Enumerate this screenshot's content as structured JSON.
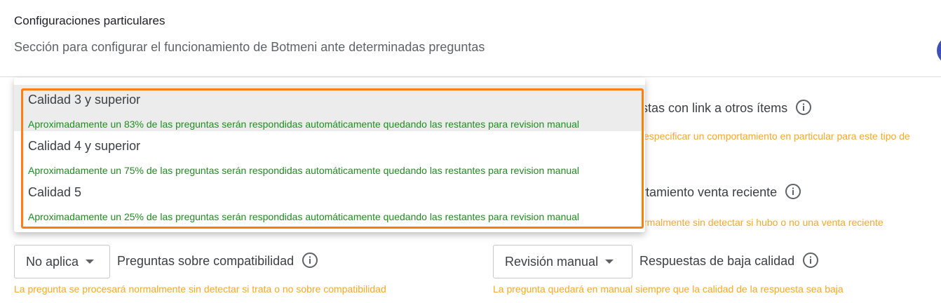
{
  "header": {
    "title": "Configuraciones particulares",
    "subtitle": "Sección para configurar el funcionamiento de Botmeni ante determinadas preguntas"
  },
  "dropdown": {
    "options": [
      {
        "title": "Calidad 3 y superior",
        "desc": "Aproximadamente un 83% de las preguntas serán respondidas automáticamente quedando las restantes para revision manual"
      },
      {
        "title": "Calidad 4 y superior",
        "desc": "Aproximadamente un 75% de las preguntas serán respondidas automáticamente quedando las restantes para revision manual"
      },
      {
        "title": "Calidad 5",
        "desc": "Aproximadamente un 25% de las preguntas serán respondidas automáticamente quedando las restantes para revision manual"
      }
    ]
  },
  "right": {
    "row1_label": "stas con link a otros ítems",
    "row1_hint": "especificar un comportamiento en particular para este tipo de",
    "row2_label": "rtamiento venta reciente",
    "row2_hint": "rmalmente sin detectar si hubo o no una venta reciente"
  },
  "bottom_left": {
    "select_value": "No aplica",
    "label": "Preguntas sobre compatibilidad",
    "hint": "La pregunta se procesará normalmente sin detectar si trata o no sobre compatibilidad"
  },
  "bottom_right": {
    "select_value": "Revisión manual",
    "label": "Respuestas de baja calidad",
    "hint": "La pregunta quedará en manual siempre que la calidad de la respuesta sea baja"
  },
  "icons": {
    "info": "info-circle-icon",
    "caret": "caret-down-icon"
  },
  "colors": {
    "hint": "#f9a825",
    "desc": "#1e8e1e",
    "highlight": "#ff7f0e",
    "selected_bg": "#ececec"
  }
}
